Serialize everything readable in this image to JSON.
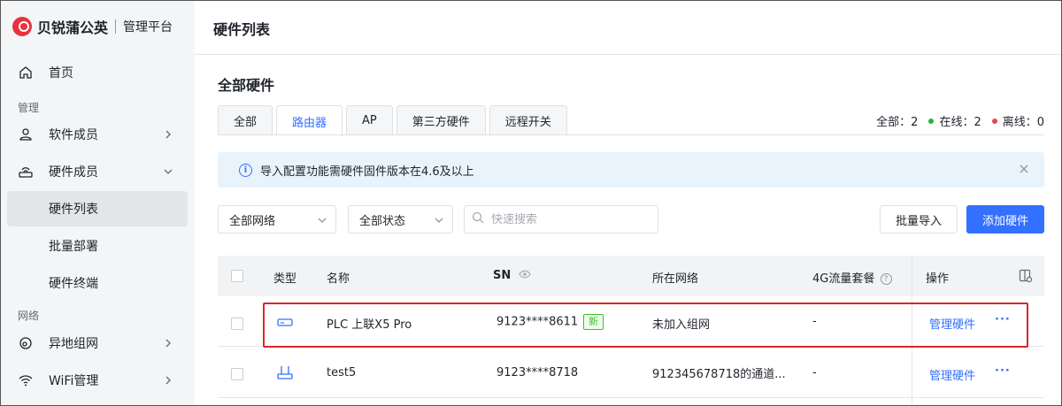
{
  "brand": {
    "name": "贝锐蒲公英",
    "sub": "管理平台"
  },
  "sidebar": {
    "home": "首页",
    "group_manage": "管理",
    "software_members": "软件成员",
    "hardware_members": "硬件成员",
    "hardware_list": "硬件列表",
    "batch_deploy": "批量部署",
    "hardware_terminal": "硬件终端",
    "group_network": "网络",
    "remote_network": "异地组网",
    "wifi_manage": "WiFi管理"
  },
  "header": {
    "title": "硬件列表"
  },
  "main": {
    "section_title": "全部硬件",
    "tabs": [
      "全部",
      "路由器",
      "AP",
      "第三方硬件",
      "远程开关"
    ],
    "stats": {
      "all_label": "全部：2",
      "online_label": "在线：2",
      "offline_label": "离线：0",
      "online_color": "#1fb83f",
      "offline_color": "#e5484d"
    },
    "notice": "导入配置功能需硬件固件版本在4.6及以上",
    "filters": {
      "network": "全部网络",
      "status": "全部状态",
      "search_placeholder": "快速搜索"
    },
    "buttons": {
      "batch_import": "批量导入",
      "add_hardware": "添加硬件"
    }
  },
  "table": {
    "headers": {
      "type": "类型",
      "name": "名称",
      "sn": "SN",
      "network": "所在网络",
      "traffic": "4G流量套餐",
      "ops": "操作"
    },
    "rows": [
      {
        "name": "PLC 上联X5 Pro",
        "sn": "9123****8611",
        "badge": "新",
        "network": "未加入组网",
        "traffic": "-",
        "action": "管理硬件",
        "more": "···"
      },
      {
        "name": "test5",
        "sn": "9123****8718",
        "badge": "",
        "network": "912345678718的通道...",
        "traffic": "-",
        "action": "管理硬件",
        "more": "···"
      }
    ]
  },
  "colors": {
    "accent": "#3370ff",
    "brand": "#e8333e",
    "highlight": "#d9262b"
  }
}
